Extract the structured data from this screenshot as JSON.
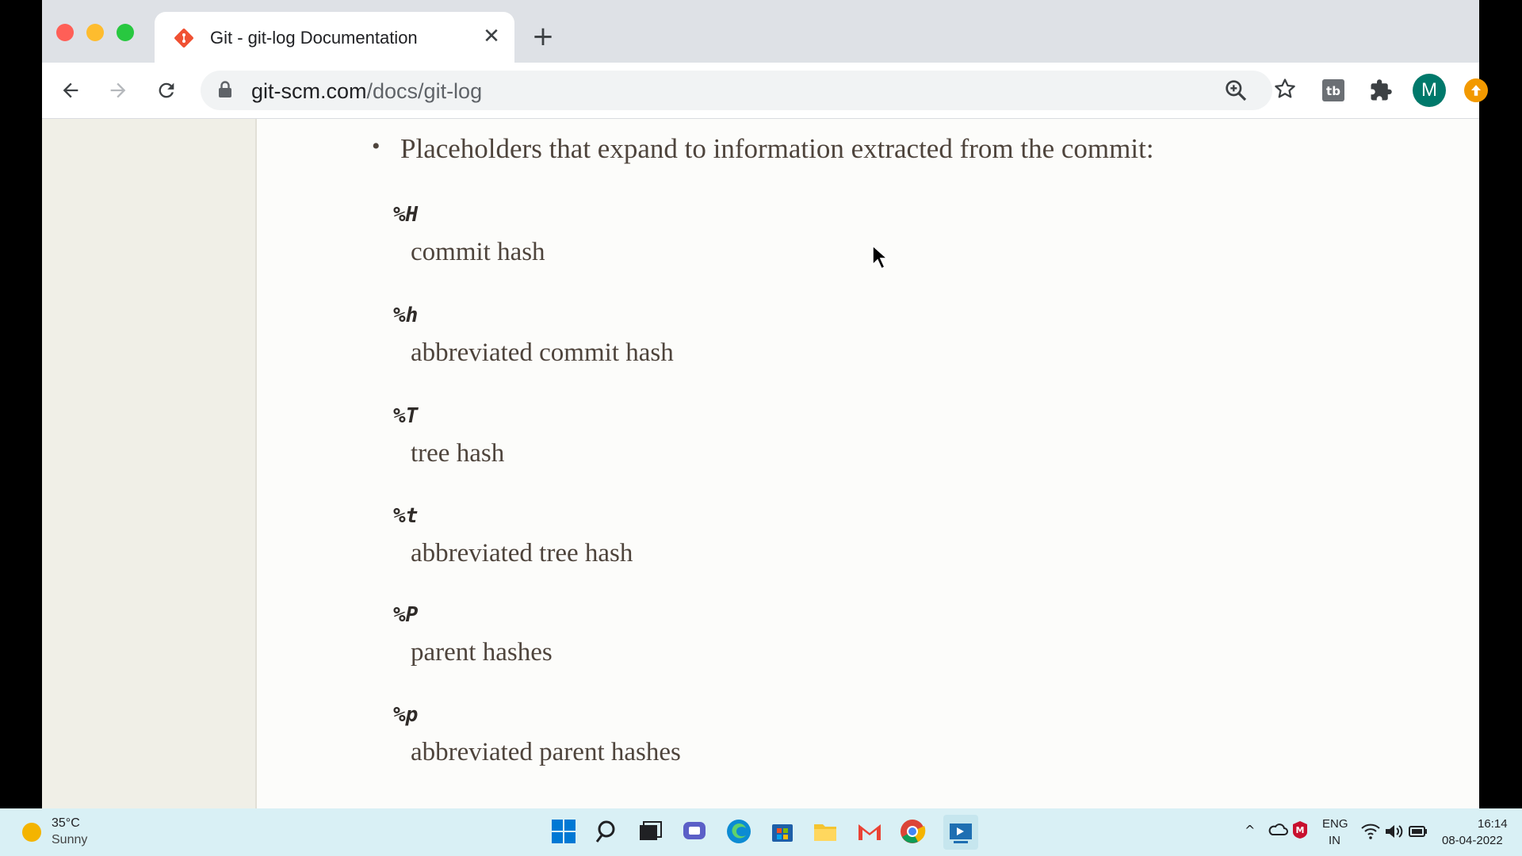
{
  "browser": {
    "tab_title": "Git - git-log Documentation",
    "tab_close": "✕",
    "new_tab": "+",
    "url_domain": "git-scm.com",
    "url_path": "/docs/git-log",
    "profile_initial": "M",
    "window_controls": {
      "minimize": "–",
      "restore": "❐",
      "close": "✕"
    }
  },
  "content": {
    "intro": "Placeholders that expand to information extracted from the commit:",
    "bullet": "•",
    "placeholders": [
      {
        "term": "%H",
        "desc": "commit hash"
      },
      {
        "term": "%h",
        "desc": "abbreviated commit hash"
      },
      {
        "term": "%T",
        "desc": "tree hash"
      },
      {
        "term": "%t",
        "desc": "abbreviated tree hash"
      },
      {
        "term": "%P",
        "desc": "parent hashes"
      },
      {
        "term": "%p",
        "desc": "abbreviated parent hashes"
      }
    ]
  },
  "taskbar": {
    "weather_temp": "35°C",
    "weather_condition": "Sunny",
    "lang_line1": "ENG",
    "lang_line2": "IN",
    "time": "16:14",
    "date": "08-04-2022"
  },
  "colors": {
    "accent_git": "#f05133",
    "profile_bg": "#00796b",
    "update_bg": "#f29900",
    "taskbar_bg": "#d9f0f5"
  }
}
